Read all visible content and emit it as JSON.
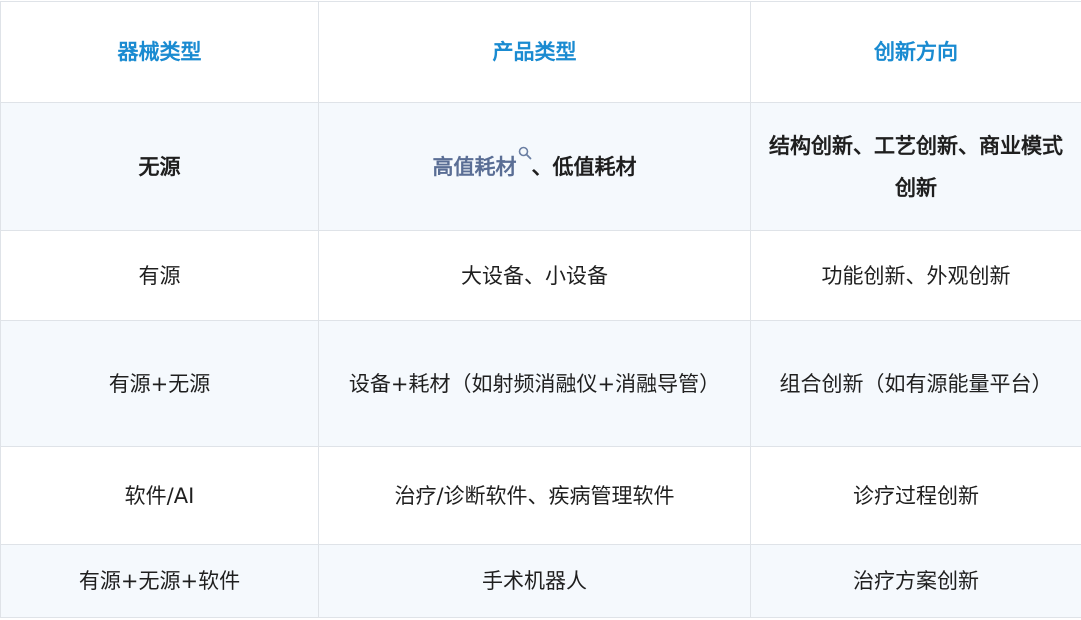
{
  "table": {
    "headers": [
      "器械类型",
      "产品类型",
      "创新方向"
    ],
    "rows": [
      {
        "type": "无源",
        "product_link": "高值耗材",
        "product_rest": "、低值耗材",
        "direction": "结构创新、工艺创新、商业模式创新"
      },
      {
        "type": "有源",
        "product": "大设备、小设备",
        "direction": "功能创新、外观创新"
      },
      {
        "type": "有源+无源",
        "product": "设备+耗材（如射频消融仪+消融导管）",
        "direction": "组合创新（如有源能量平台）"
      },
      {
        "type": "软件/AI",
        "product": "治疗/诊断软件、疾病管理软件",
        "direction": "诊疗过程创新"
      },
      {
        "type": "有源+无源+软件",
        "product": "手术机器人",
        "direction": "治疗方案创新"
      }
    ]
  },
  "icons": {
    "link_search": "search-icon"
  },
  "colors": {
    "header_text": "#1a8bd1",
    "link_text": "#5a6e95",
    "stripe": "#f5f9fd",
    "border": "#dfe3e8"
  }
}
